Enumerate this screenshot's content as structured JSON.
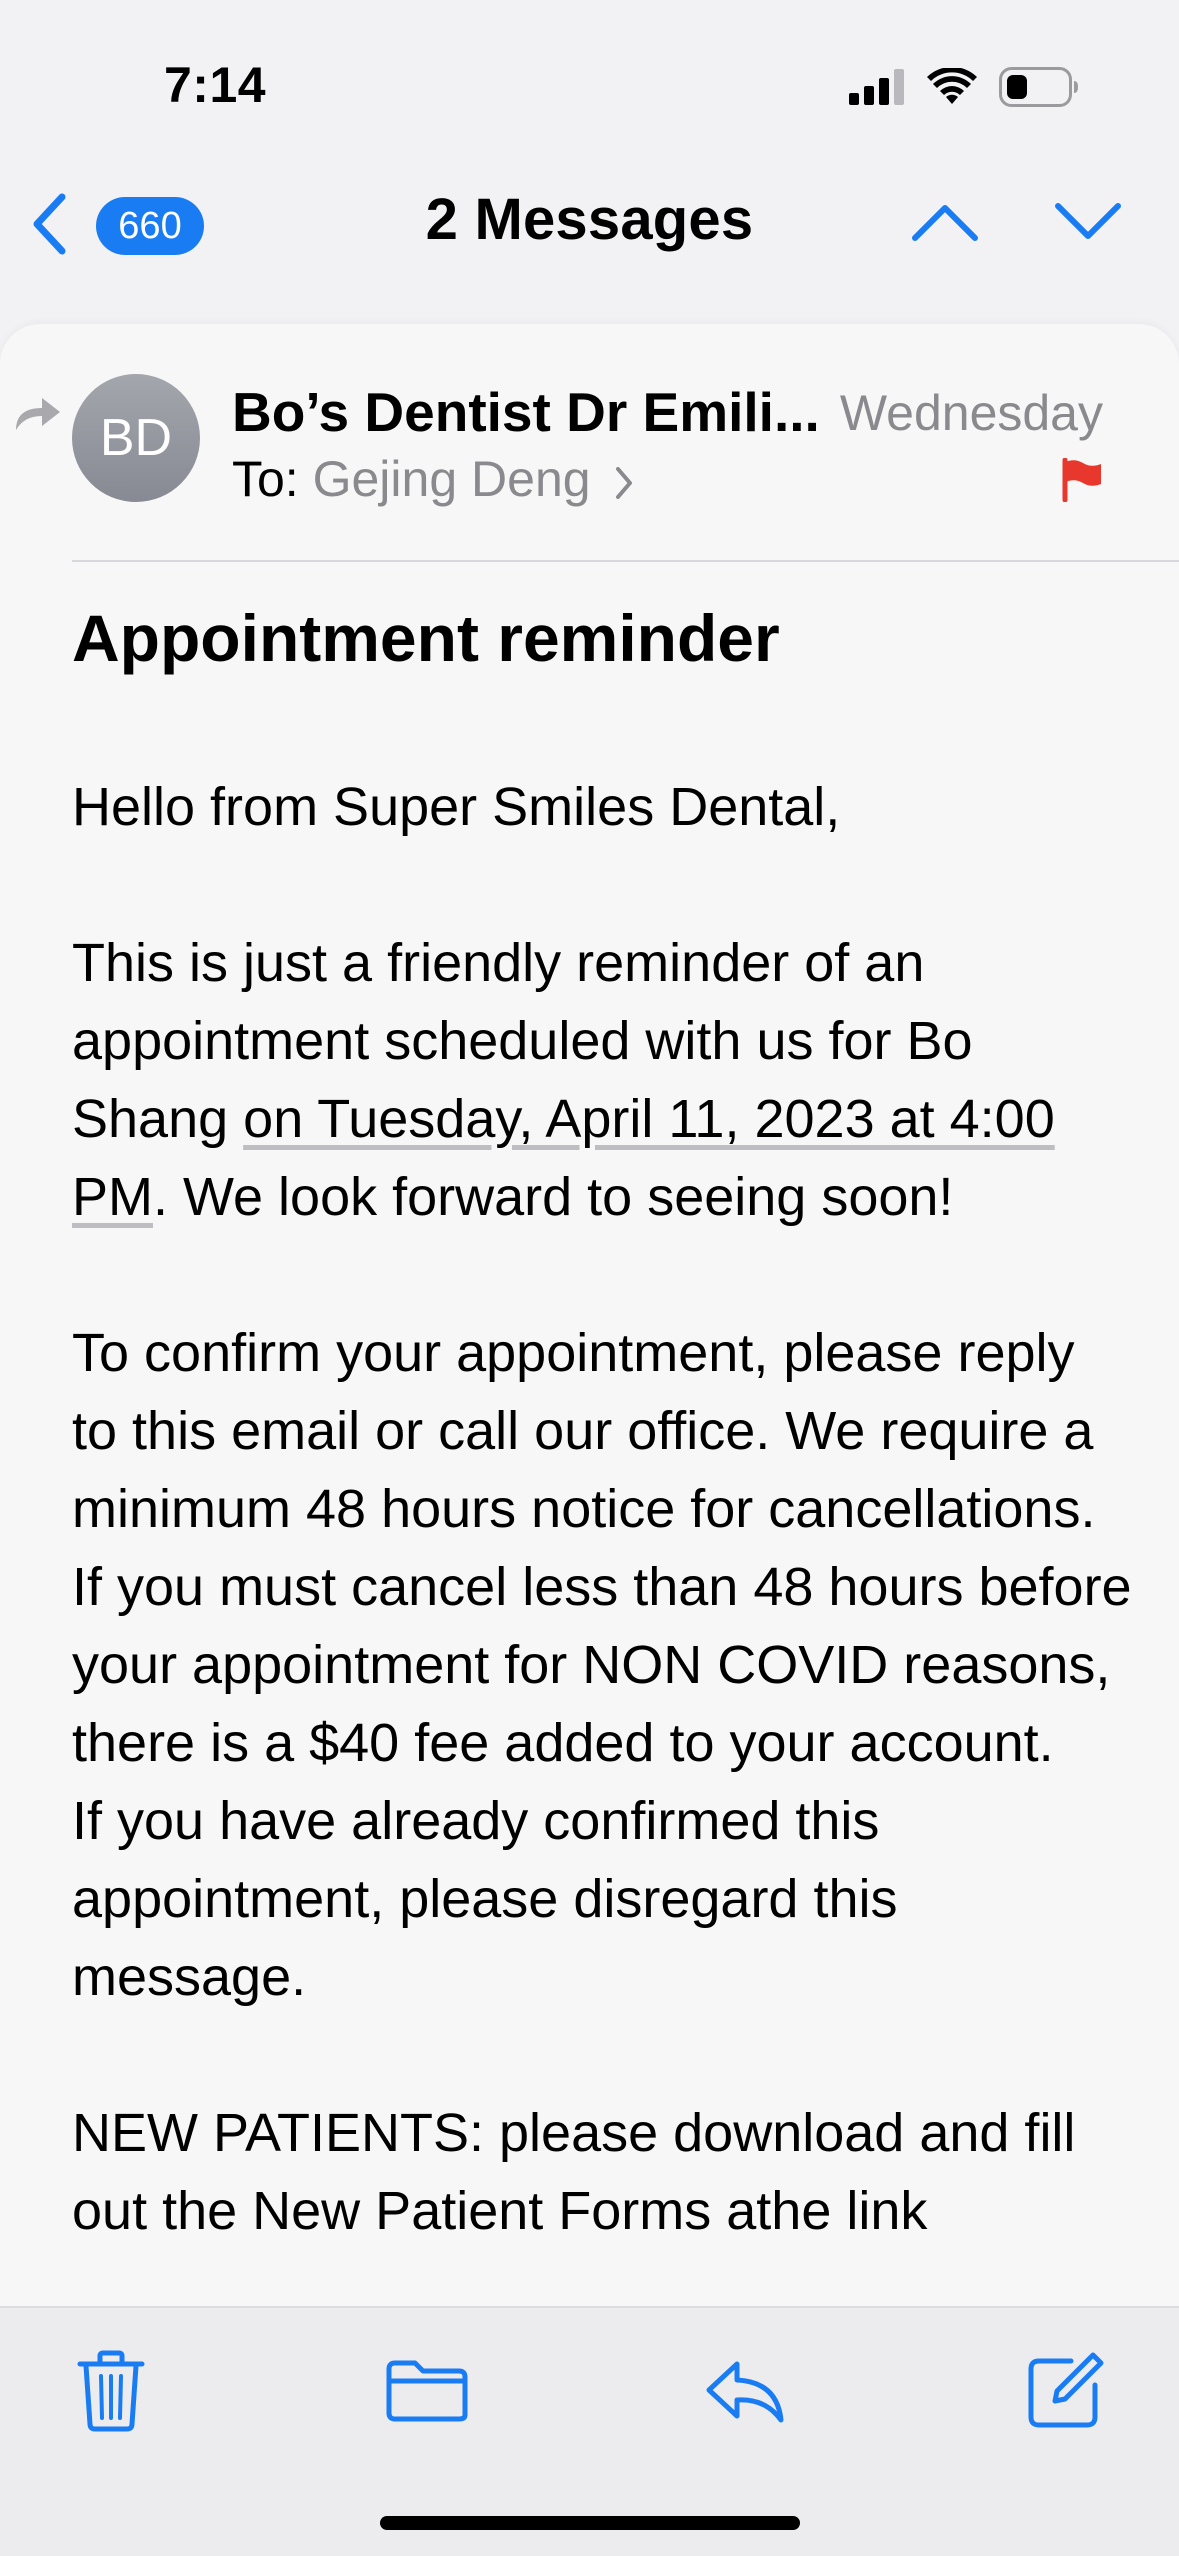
{
  "status_bar": {
    "time": "7:14"
  },
  "nav": {
    "unread_count": "660",
    "title": "2 Messages"
  },
  "message": {
    "avatar_initials": "BD",
    "sender": "Bo’s Dentist Dr Emili...",
    "date": "Wednesday",
    "to_label": "To:",
    "to_name": "Gejing Deng",
    "flag_color": "#e8372c",
    "subject": "Appointment reminder",
    "body": {
      "greeting": "Hello from Super Smiles Dental,",
      "p1_start": "This is just a friendly reminder of an appointment scheduled with us for Bo Shang ",
      "p1_date": "on Tuesday, April 11, 2023 at 4:00 PM",
      "p1_end": ". We look forward to seeing soon!",
      "p2": "To confirm your appointment, please reply to this email or call our office. We require a minimum 48 hours notice for cancellations. If you must cancel less than 48 hours before your appointment for NON COVID reasons, there is a $40 fee added to your account.",
      "p3": "If you have already confirmed this appointment, please disregard this message.",
      "p4": "NEW PATIENTS: please download and fill out the New Patient Forms athe link"
    }
  },
  "toolbar": {
    "icons": [
      "trash-icon",
      "folder-icon",
      "reply-icon",
      "compose-icon"
    ]
  },
  "colors": {
    "accent": "#1a7cf2",
    "secondary_text": "#8a8a8e",
    "background": "#f2f2f4"
  }
}
